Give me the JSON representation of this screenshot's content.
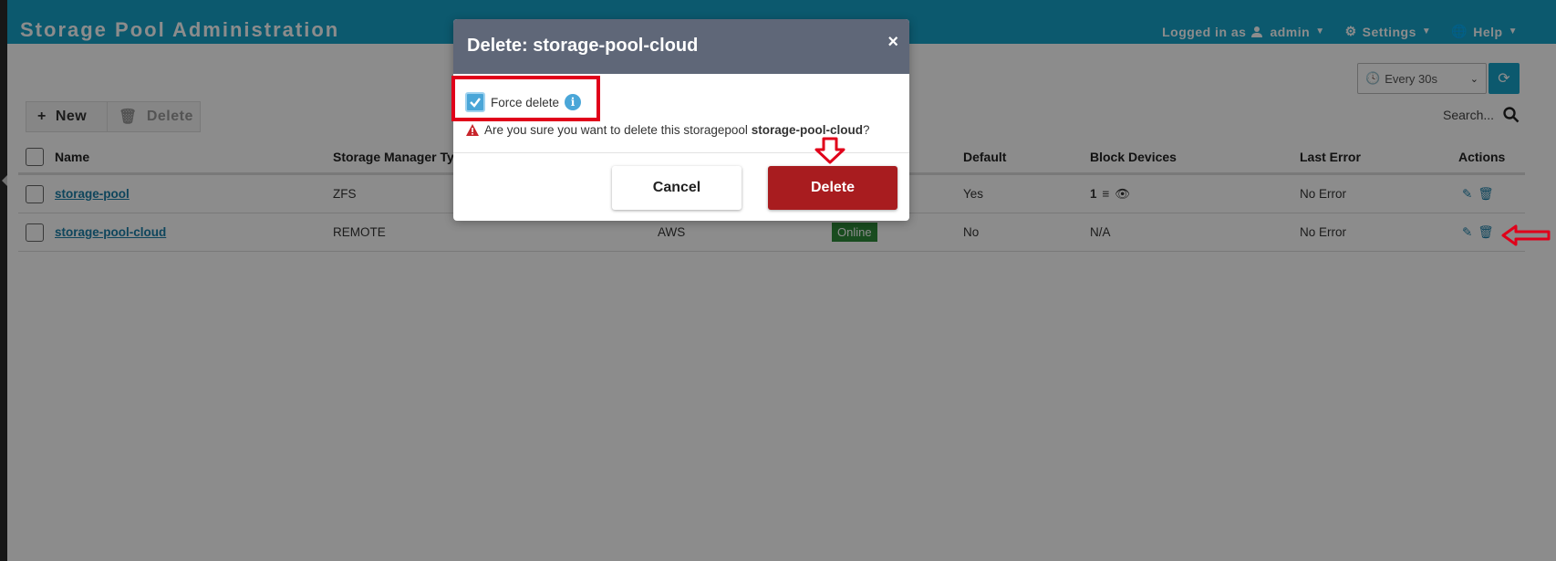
{
  "header": {
    "title": "Storage Pool Administration",
    "logged_in_label": "Logged in as",
    "user": "admin",
    "settings": "Settings",
    "help": "Help"
  },
  "refresh": {
    "selected": "Every 30s"
  },
  "toolbar": {
    "new_label": "New",
    "delete_label": "Delete"
  },
  "search": {
    "placeholder": "Search..."
  },
  "table": {
    "columns": [
      "Name",
      "Storage Manager Type",
      "Default",
      "Block Devices",
      "Last Error",
      "Actions"
    ],
    "rows": [
      {
        "name": "storage-pool",
        "type": "ZFS",
        "provider": "",
        "status": "",
        "default": "Yes",
        "block_devices": "1",
        "last_error": "No Error"
      },
      {
        "name": "storage-pool-cloud",
        "type": "REMOTE",
        "provider": "AWS",
        "status": "Online",
        "default": "No",
        "block_devices": "N/A",
        "last_error": "No Error"
      }
    ]
  },
  "modal": {
    "title": "Delete: storage-pool-cloud",
    "close": "×",
    "force_label": "Force delete",
    "info_glyph": "i",
    "warning_text": "Are you sure you want to delete this storagepool",
    "warning_target": "storage-pool-cloud",
    "warning_end": "?",
    "cancel_label": "Cancel",
    "delete_label": "Delete"
  },
  "colors": {
    "header": "#17a2c9",
    "danger": "#a81c1f",
    "annotation": "#e0001a",
    "online": "#2e8b3a"
  }
}
